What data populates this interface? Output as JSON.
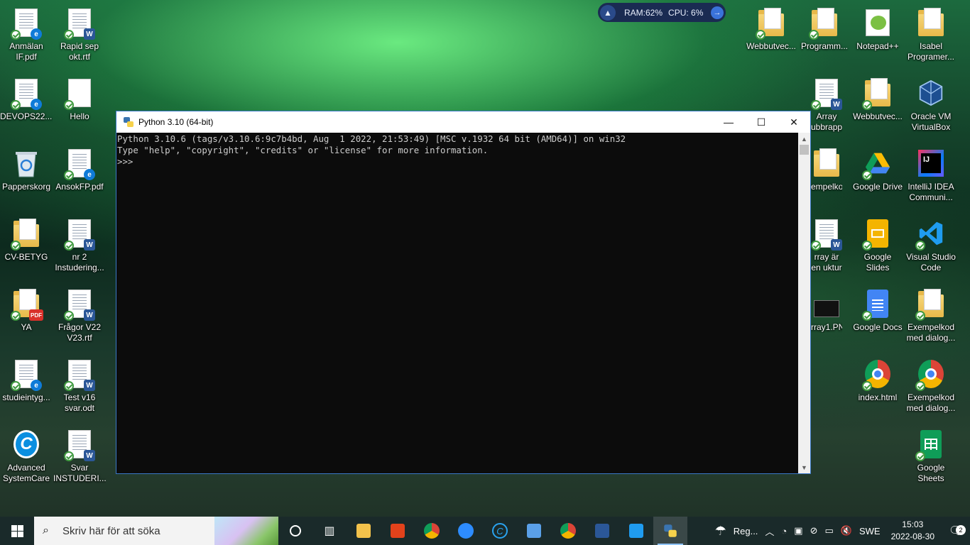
{
  "sysmon": {
    "ram": "RAM:62%",
    "cpu": "CPU: 6%"
  },
  "desktop_icons": {
    "anmalan": "Anmälan IF.pdf",
    "rapid": "Rapid sep okt.rtf",
    "devops": "DEVOPS22....",
    "hello": "Hello",
    "papperskorg": "Papperskorg",
    "ansokfp": "AnsokFP.pdf",
    "cvbetyg": "CV-BETYG",
    "nr2": "nr 2 Instudering...",
    "ya": "YA",
    "fragor": "Frågor V22 V23.rtf",
    "studieintyg": "studieintyg...",
    "testv16": "Test v16 svar.odt",
    "asc": "Advanced SystemCare",
    "svar": "Svar INSTUDERI...",
    "webbutvec1": "Webbutvec...",
    "programm": "Programm...",
    "notepad": "Notepad++",
    "isabel": "Isabel Programer...",
    "array": "Array ubbrappo...",
    "webbutvec2": "Webbutvec...",
    "oracle": "Oracle VM VirtualBox",
    "exempelko": "empelko...",
    "gdrive": "Google Drive",
    "intellij": "IntelliJ IDEA Communi...",
    "arrayar": "rray är en uktur so...",
    "gslides": "Google Slides",
    "vscode": "Visual Studio Code",
    "array1": "rray1.PNG",
    "gdocs": "Google Docs",
    "exempelkod1": "Exempelkod med dialog...",
    "indexhtml": "index.html",
    "exempelkod2": "Exempelkod med dialog...",
    "gsheets": "Google Sheets"
  },
  "python_window": {
    "title": "Python 3.10 (64-bit)",
    "minimize": "—",
    "maximize": "☐",
    "close": "✕",
    "line1": "Python 3.10.6 (tags/v3.10.6:9c7b4bd, Aug  1 2022, 21:53:49) [MSC v.1932 64 bit (AMD64)] on win32",
    "line2": "Type \"help\", \"copyright\", \"credits\" or \"license\" for more information.",
    "line3": ">>>"
  },
  "taskbar": {
    "search_placeholder": "Skriv här för att söka",
    "weather": "Reg...",
    "language": "SWE",
    "time": "15:03",
    "date": "2022-08-30",
    "notification_count": "2"
  },
  "colors": {
    "taskbar_bg": "#1a2a2a",
    "console_bg": "#0c0c0c",
    "console_fg": "#cccccc",
    "window_border": "#3a78c8"
  }
}
